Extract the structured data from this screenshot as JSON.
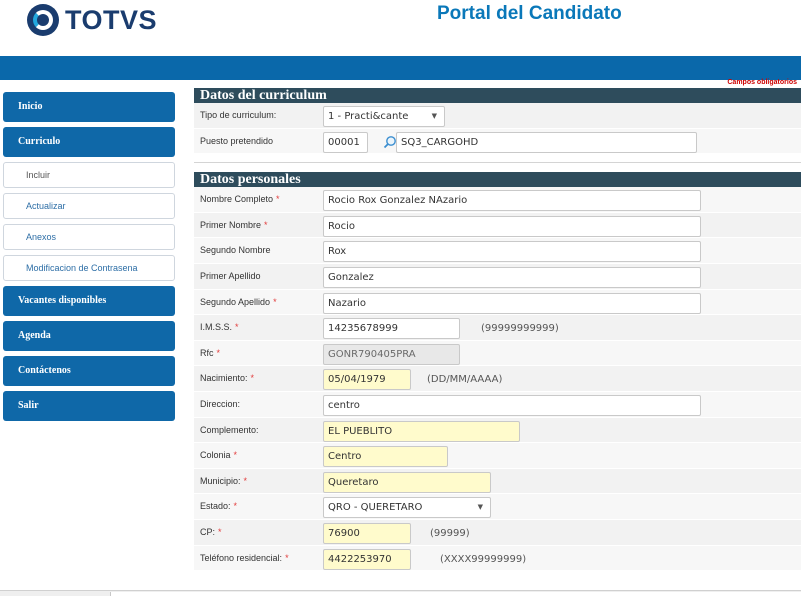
{
  "brand": {
    "logo_text": "TOTVS",
    "portal_title": "Portal del Candidato"
  },
  "required_note": "Campos obligatorios",
  "sidebar": {
    "items": [
      {
        "label": "Inicio"
      },
      {
        "label": "Curriculo"
      },
      {
        "label": "Incluir"
      },
      {
        "label": "Actualizar"
      },
      {
        "label": "Anexos"
      },
      {
        "label": "Modificacion de Contrasena"
      },
      {
        "label": "Vacantes disponibles"
      },
      {
        "label": "Agenda"
      },
      {
        "label": "Contáctenos"
      },
      {
        "label": "Salir"
      }
    ]
  },
  "curriculum": {
    "title": "Datos del curriculum",
    "tipo_label": "Tipo de curriculum:",
    "tipo_value": "1 - Practi&cante",
    "puesto_label": "Puesto pretendido",
    "puesto_code": "00001",
    "puesto_desc": "SQ3_CARGOHD"
  },
  "personal": {
    "title": "Datos personales",
    "fields": [
      {
        "label": "Nombre Completo",
        "req": "*",
        "value": "Rocio Rox Gonzalez NAzario"
      },
      {
        "label": "Primer Nombre",
        "req": "*",
        "value": "Rocio"
      },
      {
        "label": "Segundo Nombre",
        "req": "",
        "value": "Rox"
      },
      {
        "label": "Primer Apellido",
        "req": "",
        "value": "Gonzalez"
      },
      {
        "label": "Segundo Apellido",
        "req": "*",
        "value": "Nazario"
      },
      {
        "label": "I.M.S.S.",
        "req": "*",
        "value": "14235678999",
        "hint": "(99999999999)"
      },
      {
        "label": "Rfc",
        "req": "*",
        "value": "GONR790405PRA"
      },
      {
        "label": "Nacimiento:",
        "req": "*",
        "value": "05/04/1979",
        "hint": "(DD/MM/AAAA)"
      },
      {
        "label": "Direccion:",
        "req": "",
        "value": "centro"
      },
      {
        "label": "Complemento:",
        "req": "",
        "value": "EL PUEBLITO"
      },
      {
        "label": "Colonia",
        "req": "*",
        "value": "Centro"
      },
      {
        "label": "Municipio:",
        "req": "*",
        "value": "Queretaro"
      },
      {
        "label": "Estado:",
        "req": "*",
        "value": "QRO - QUERETARO"
      },
      {
        "label": "CP:",
        "req": "*",
        "value": "76900",
        "hint": "(99999)"
      },
      {
        "label": "Teléfono residencial:",
        "req": "*",
        "value": "4422253970",
        "hint": "(XXXX99999999)"
      }
    ]
  }
}
